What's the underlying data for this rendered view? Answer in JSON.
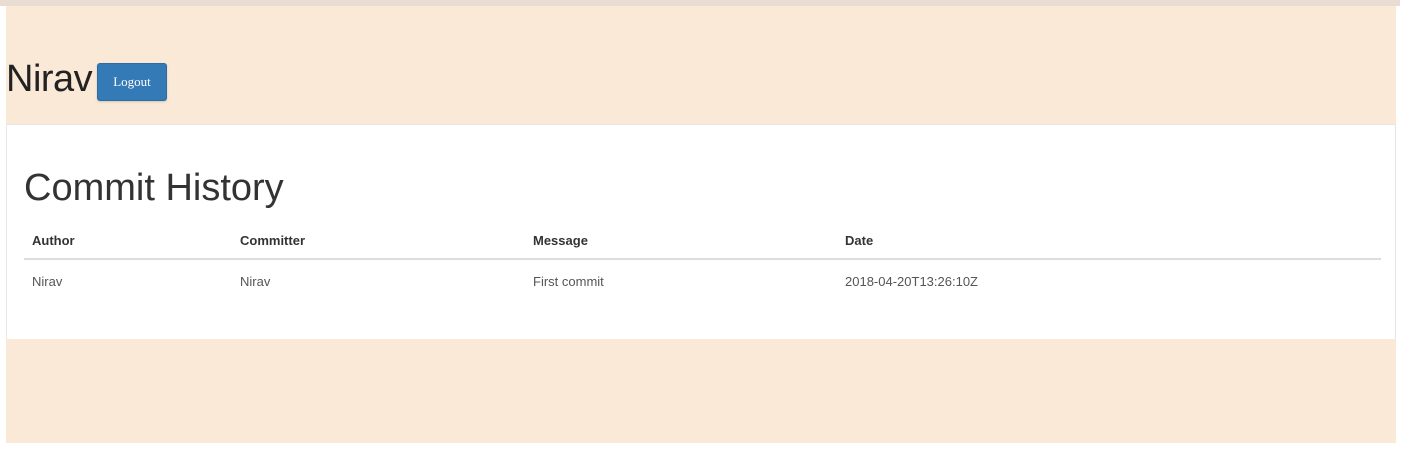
{
  "header": {
    "username": "Nirav",
    "logout_label": "Logout"
  },
  "main": {
    "title": "Commit History",
    "columns": [
      "Author",
      "Committer",
      "Message",
      "Date"
    ],
    "rows": [
      [
        "Nirav",
        "Nirav",
        "First commit",
        "2018-04-20T13:26:10Z"
      ]
    ]
  },
  "colors": {
    "header_bg": "#f9e9d6",
    "button_bg": "#337ab7"
  }
}
